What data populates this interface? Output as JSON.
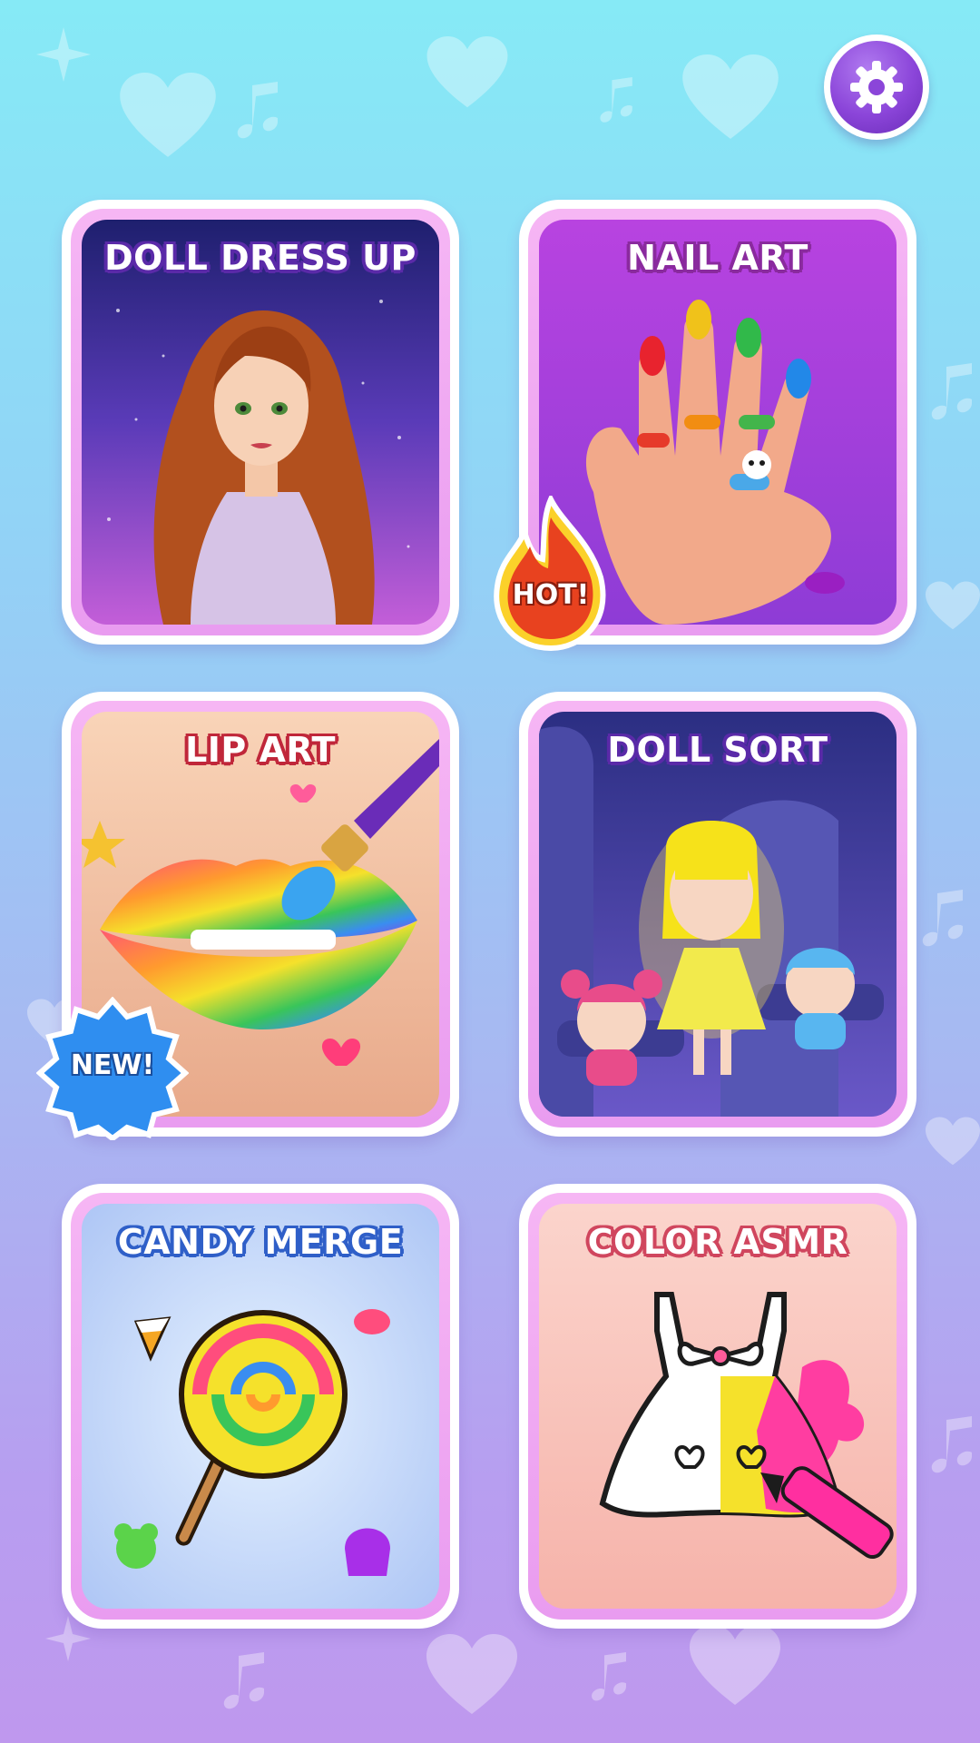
{
  "settings": {
    "icon": "gear-icon"
  },
  "games": [
    {
      "title": "DOLL DRESS UP",
      "badge": null
    },
    {
      "title": "NAIL ART",
      "badge": "HOT!"
    },
    {
      "title": "LIP ART",
      "badge": "NEW!"
    },
    {
      "title": "DOLL SORT",
      "badge": null
    },
    {
      "title": "CANDY MERGE",
      "badge": null
    },
    {
      "title": "COLOR ASMR",
      "badge": null
    }
  ],
  "colors": {
    "background_top": "#86eaf6",
    "background_bottom": "#bf98ee",
    "settings_accent": "#8b45d9",
    "card_border": "#e99cf0",
    "hot_badge": "#e8421f",
    "new_badge": "#2f8ef0"
  }
}
